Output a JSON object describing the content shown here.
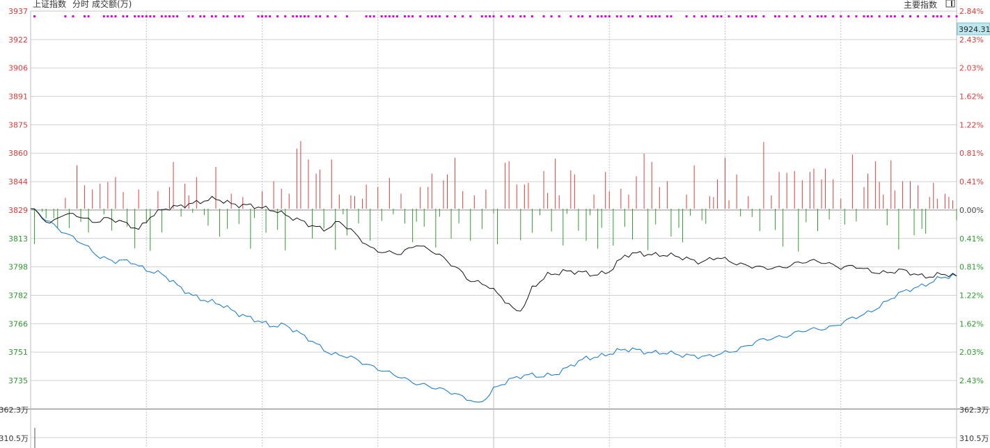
{
  "header": {
    "index_name": "上证指数",
    "view_mode": "分时",
    "volume_label": "成交额(万)",
    "main_indices_button": "主要指数"
  },
  "price_tag": "3924.31",
  "chart_data": {
    "type": "line",
    "title": "",
    "reference_price": 3829,
    "ylim": [
      3719.5,
      3937
    ],
    "y_ticks_left": [
      "3937",
      "3922",
      "3906",
      "3891",
      "3875",
      "3860",
      "3844",
      "3829",
      "3813",
      "3798",
      "3782",
      "3766",
      "3751",
      "3735"
    ],
    "y_ticks_right": [
      "2.84%",
      "2.43%",
      "2.03%",
      "1.62%",
      "1.22%",
      "0.81%",
      "0.41%",
      "0.00%",
      "0.41%",
      "0.81%",
      "1.22%",
      "1.62%",
      "2.03%",
      "2.43%"
    ],
    "volume_ticks_left": [
      "362.3万",
      "310.5万"
    ],
    "volume_ticks_right": [
      "362.3万",
      "310.5万"
    ],
    "n_points": 241,
    "colors": {
      "up": "#e03b3b",
      "down": "#2e9a2e",
      "black_line": "#111111",
      "blue_line": "#1e7fd0",
      "marker": "#e000e0",
      "left_tick_red": "#e03b3b",
      "left_tick_green": "#2e9a2e",
      "price_tag_bg": "#bde8ef"
    },
    "series": [
      {
        "line": "black",
        "keys": [
          [
            0,
            3829
          ],
          [
            2,
            3826
          ],
          [
            5,
            3821
          ],
          [
            8,
            3826
          ],
          [
            12,
            3825
          ],
          [
            16,
            3822
          ],
          [
            20,
            3824
          ],
          [
            24,
            3821
          ],
          [
            28,
            3818
          ],
          [
            31,
            3825
          ],
          [
            34,
            3828
          ],
          [
            38,
            3830
          ],
          [
            41,
            3832
          ],
          [
            44,
            3833
          ],
          [
            48,
            3834
          ],
          [
            52,
            3832
          ],
          [
            56,
            3831
          ],
          [
            60,
            3829
          ],
          [
            64,
            3828
          ],
          [
            68,
            3824
          ],
          [
            72,
            3820
          ],
          [
            76,
            3818
          ],
          [
            80,
            3822
          ],
          [
            84,
            3815
          ],
          [
            88,
            3808
          ],
          [
            92,
            3805
          ],
          [
            96,
            3804
          ],
          [
            100,
            3810
          ],
          [
            104,
            3806
          ],
          [
            108,
            3800
          ],
          [
            111,
            3796
          ],
          [
            114,
            3790
          ],
          [
            118,
            3787
          ],
          [
            122,
            3781
          ],
          [
            126,
            3773
          ],
          [
            128,
            3776
          ],
          [
            130,
            3785
          ],
          [
            134,
            3793
          ],
          [
            138,
            3795
          ],
          [
            142,
            3794
          ],
          [
            146,
            3793
          ],
          [
            150,
            3795
          ],
          [
            154,
            3803
          ],
          [
            158,
            3805
          ],
          [
            162,
            3804
          ],
          [
            166,
            3803
          ],
          [
            170,
            3802
          ],
          [
            174,
            3800
          ],
          [
            178,
            3802
          ],
          [
            182,
            3800
          ],
          [
            186,
            3798
          ],
          [
            190,
            3796
          ],
          [
            194,
            3797
          ],
          [
            198,
            3799
          ],
          [
            202,
            3800
          ],
          [
            206,
            3800
          ],
          [
            210,
            3797
          ],
          [
            214,
            3797
          ],
          [
            218,
            3795
          ],
          [
            222,
            3794
          ],
          [
            226,
            3795
          ],
          [
            230,
            3793
          ],
          [
            234,
            3792
          ],
          [
            236,
            3793
          ],
          [
            240,
            3792
          ]
        ]
      },
      {
        "line": "blue",
        "keys": [
          [
            0,
            3829
          ],
          [
            5,
            3822
          ],
          [
            10,
            3814
          ],
          [
            14,
            3809
          ],
          [
            18,
            3803
          ],
          [
            22,
            3800
          ],
          [
            26,
            3800
          ],
          [
            30,
            3796
          ],
          [
            34,
            3793
          ],
          [
            38,
            3787
          ],
          [
            42,
            3782
          ],
          [
            46,
            3778
          ],
          [
            50,
            3776
          ],
          [
            54,
            3772
          ],
          [
            58,
            3768
          ],
          [
            62,
            3765
          ],
          [
            66,
            3766
          ],
          [
            70,
            3760
          ],
          [
            74,
            3755
          ],
          [
            78,
            3750
          ],
          [
            82,
            3748
          ],
          [
            86,
            3745
          ],
          [
            90,
            3742
          ],
          [
            94,
            3738
          ],
          [
            98,
            3735
          ],
          [
            102,
            3733
          ],
          [
            106,
            3730
          ],
          [
            110,
            3728
          ],
          [
            114,
            3725
          ],
          [
            116,
            3722
          ],
          [
            118,
            3725
          ],
          [
            120,
            3730
          ],
          [
            124,
            3736
          ],
          [
            128,
            3738
          ],
          [
            132,
            3737
          ],
          [
            136,
            3739
          ],
          [
            140,
            3743
          ],
          [
            144,
            3747
          ],
          [
            148,
            3749
          ],
          [
            152,
            3751
          ],
          [
            156,
            3752
          ],
          [
            160,
            3751
          ],
          [
            164,
            3750
          ],
          [
            168,
            3749
          ],
          [
            172,
            3749
          ],
          [
            176,
            3748
          ],
          [
            180,
            3750
          ],
          [
            184,
            3753
          ],
          [
            188,
            3756
          ],
          [
            192,
            3758
          ],
          [
            196,
            3760
          ],
          [
            200,
            3762
          ],
          [
            204,
            3763
          ],
          [
            208,
            3765
          ],
          [
            212,
            3768
          ],
          [
            216,
            3771
          ],
          [
            220,
            3776
          ],
          [
            224,
            3781
          ],
          [
            228,
            3785
          ],
          [
            232,
            3788
          ],
          [
            236,
            3791
          ],
          [
            240,
            3792
          ]
        ]
      }
    ],
    "volume_bars": {
      "up_indices": [
        9,
        12,
        14,
        16,
        18,
        20,
        22,
        24,
        28,
        33,
        36,
        37,
        40,
        41,
        43,
        48,
        52,
        55,
        60,
        63,
        65,
        67,
        69,
        70,
        72,
        74,
        75,
        78,
        80,
        83,
        84,
        86,
        87,
        90,
        93,
        96,
        101,
        103,
        104,
        107,
        108,
        110,
        112,
        115,
        118,
        123,
        124,
        126,
        128,
        129,
        133,
        134,
        136,
        137,
        140,
        141,
        146,
        149,
        150,
        153,
        155,
        157,
        159,
        161,
        163,
        165,
        170,
        172,
        176,
        177,
        178,
        180,
        181,
        183,
        186,
        190,
        192,
        194,
        196,
        198,
        200,
        202,
        203,
        205,
        206,
        208,
        210,
        213,
        216,
        217,
        219,
        220,
        221,
        223,
        224,
        226,
        228,
        230,
        233,
        234,
        235,
        237,
        238,
        239
      ],
      "up_values": [
        1.3,
        5.2,
        2.8,
        2.3,
        3.0,
        3.2,
        3.8,
        2.0,
        2.3,
        2.1,
        2.6,
        5.6,
        3.0,
        1.6,
        3.8,
        5.0,
        1.8,
        1.4,
        2.1,
        3.3,
        2.4,
        1.8,
        7.2,
        8.1,
        5.9,
        4.2,
        4.7,
        5.9,
        1.7,
        1.6,
        1.5,
        1.2,
        2.9,
        2.6,
        3.7,
        1.8,
        2.6,
        2.6,
        4.2,
        3.4,
        4.1,
        6.1,
        2.1,
        1.6,
        2.3,
        5.5,
        5.7,
        2.9,
        2.9,
        3.1,
        4.5,
        1.9,
        6.0,
        1.6,
        4.6,
        4.1,
        1.7,
        4.4,
        2.1,
        2.4,
        1.7,
        3.9,
        6.6,
        5.6,
        2.6,
        3.3,
        1.7,
        5.2,
        1.5,
        1.4,
        3.5,
        6.1,
        1.0,
        4.1,
        1.5,
        8.0,
        1.6,
        4.4,
        4.3,
        4.5,
        3.4,
        4.4,
        4.8,
        3.5,
        4.8,
        3.5,
        1.2,
        6.5,
        2.6,
        4.2,
        5.7,
        3.2,
        1.7,
        5.8,
        2.2,
        3.3,
        3.3,
        2.8,
        1.4,
        3.1,
        1.2,
        1.8,
        1.4,
        1.0
      ]
    },
    "top_marker_indices": [
      1,
      9,
      11,
      14,
      15,
      19,
      20,
      21,
      22,
      24,
      25,
      27,
      28,
      29,
      30,
      31,
      32,
      34,
      35,
      36,
      37,
      38,
      41,
      42,
      44,
      45,
      47,
      48,
      50,
      51,
      53,
      54,
      55,
      59,
      60,
      61,
      62,
      64,
      66,
      68,
      69,
      70,
      71,
      72,
      74,
      75,
      77,
      79,
      82,
      87,
      88,
      89,
      91,
      92,
      93,
      94,
      95,
      97,
      98,
      99,
      101,
      103,
      104,
      105,
      106,
      108,
      110,
      112,
      114,
      117,
      118,
      119,
      120,
      122,
      124,
      125,
      127,
      128,
      130,
      133,
      135,
      137,
      140,
      142,
      143,
      145,
      147,
      148,
      149,
      150,
      152,
      153,
      155,
      156,
      158,
      160,
      161,
      162,
      163,
      165,
      166,
      170,
      172,
      174,
      175,
      177,
      178,
      179,
      181,
      183,
      184,
      186,
      187,
      188,
      190,
      193,
      194,
      196,
      198,
      200,
      202,
      204,
      205,
      206,
      208,
      210,
      212,
      214,
      216,
      217,
      218,
      220,
      222,
      223,
      224,
      226,
      228,
      230,
      232,
      234,
      235,
      236,
      238,
      240
    ]
  }
}
